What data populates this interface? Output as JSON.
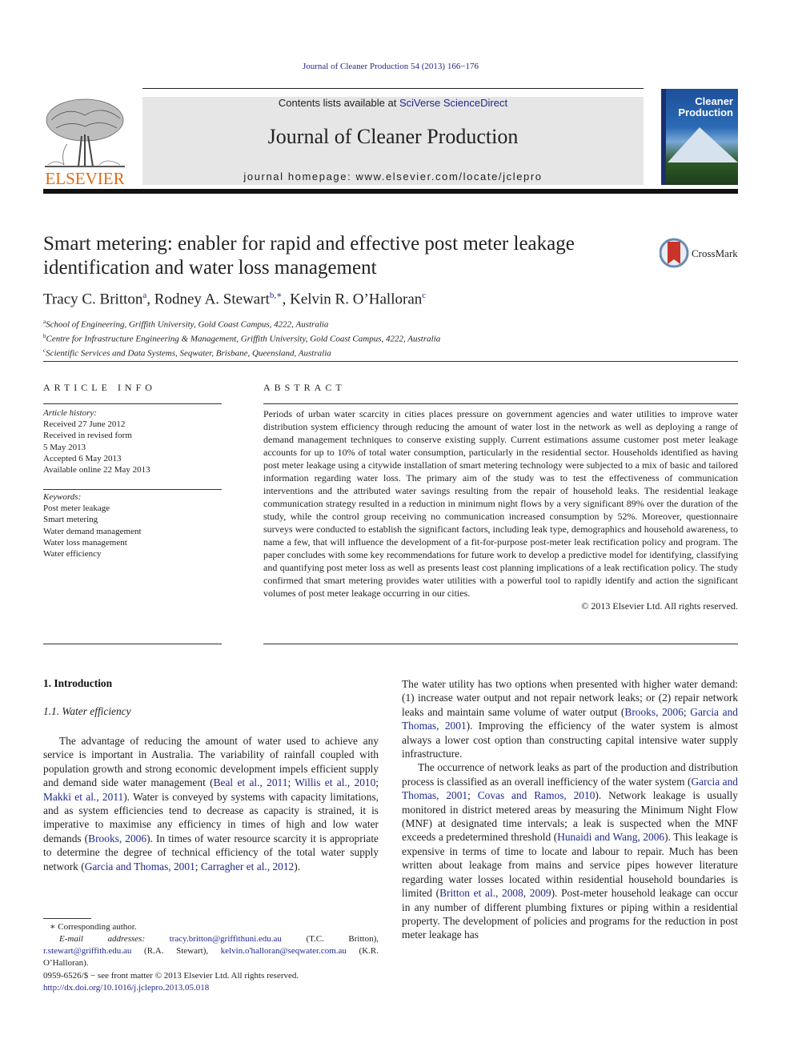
{
  "header": {
    "citation": "Journal of Cleaner Production 54 (2013) 166−176",
    "contents_prefix": "Contents lists available at ",
    "contents_link": "SciVerse ScienceDirect",
    "journal_title": "Journal of Cleaner Production",
    "homepage": "journal homepage: www.elsevier.com/locate/jclepro",
    "publisher": "ELSEVIER",
    "cover": {
      "line1": "Cleaner",
      "line2": "Production"
    },
    "colors": {
      "link": "#1f2a8a",
      "elsevier_orange": "#e06a10",
      "banner_gray": "#e6e6e6"
    }
  },
  "article": {
    "title": "Smart metering: enabler for rapid and effective post meter leakage identification and water loss management",
    "crossmark": "CrossMark",
    "authors": [
      {
        "name": "Tracy C. Britton",
        "sup": "a"
      },
      {
        "name": "Rodney A. Stewart",
        "sup": "b,∗"
      },
      {
        "name": "Kelvin R. O’Halloran",
        "sup": "c"
      }
    ],
    "affiliations": [
      {
        "sup": "a",
        "text": "School of Engineering, Griffith University, Gold Coast Campus, 4222, Australia"
      },
      {
        "sup": "b",
        "text": "Centre for Infrastructure Engineering & Management, Griffith University, Gold Coast Campus, 4222, Australia"
      },
      {
        "sup": "c",
        "text": "Scientific Services and Data Systems, Seqwater, Brisbane, Queensland, Australia"
      }
    ]
  },
  "article_info": {
    "heading": "ARTICLE INFO",
    "history_label": "Article history:",
    "history": [
      "Received 27 June 2012",
      "Received in revised form",
      "5 May 2013",
      "Accepted 6 May 2013",
      "Available online 22 May 2013"
    ],
    "keywords_label": "Keywords:",
    "keywords": [
      "Post meter leakage",
      "Smart metering",
      "Water demand management",
      "Water loss management",
      "Water efficiency"
    ]
  },
  "abstract": {
    "heading": "ABSTRACT",
    "text": "Periods of urban water scarcity in cities places pressure on government agencies and water utilities to improve water distribution system efficiency through reducing the amount of water lost in the network as well as deploying a range of demand management techniques to conserve existing supply. Current estimations assume customer post meter leakage accounts for up to 10% of total water consumption, particularly in the residential sector. Households identified as having post meter leakage using a citywide installation of smart metering technology were subjected to a mix of basic and tailored information regarding water loss. The primary aim of the study was to test the effectiveness of communication interventions and the attributed water savings resulting from the repair of household leaks. The residential leakage communication strategy resulted in a reduction in minimum night flows by a very significant 89% over the duration of the study, while the control group receiving no communication increased consumption by 52%. Moreover, questionnaire surveys were conducted to establish the significant factors, including leak type, demographics and household awareness, to name a few, that will influence the development of a fit-for-purpose post-meter leak rectification policy and program. The paper concludes with some key recommendations for future work to develop a predictive model for identifying, classifying and quantifying post meter loss as well as presents least cost planning implications of a leak rectification policy. The study confirmed that smart metering provides water utilities with a powerful tool to rapidly identify and action the significant volumes of post meter leakage occurring in our cities.",
    "copyright": "© 2013 Elsevier Ltd. All rights reserved."
  },
  "body": {
    "section_heading": "1.  Introduction",
    "subsection_heading": "1.1.  Water efficiency",
    "left_para": [
      {
        "t": "The advantage of reducing the amount of water used to achieve any service is important in Australia. The variability of rainfall coupled with population growth and strong economic development impels efficient supply and demand side water management ("
      },
      {
        "l": "Beal et al., 2011"
      },
      {
        "t": "; "
      },
      {
        "l": "Willis et al., 2010"
      },
      {
        "t": "; "
      },
      {
        "l": "Makki et al., 2011"
      },
      {
        "t": "). Water is conveyed by systems with capacity limitations, and as system efficiencies tend to decrease as capacity is strained, it is imperative to maximise any efficiency in times of high and low water demands ("
      },
      {
        "l": "Brooks, 2006"
      },
      {
        "t": "). In times of water resource scarcity it is appropriate to determine the degree of technical efficiency of the total water supply network ("
      },
      {
        "l": "Garcia and Thomas, 2001"
      },
      {
        "t": "; "
      },
      {
        "l": "Carragher et al., 2012"
      },
      {
        "t": ")."
      }
    ],
    "right_para1": [
      {
        "t": "The water utility has two options when presented with higher water demand: (1) increase water output and not repair network leaks; or (2) repair network leaks and maintain same volume of water output ("
      },
      {
        "l": "Brooks, 2006"
      },
      {
        "t": "; "
      },
      {
        "l": "Garcia and Thomas, 2001"
      },
      {
        "t": "). Improving the efficiency of the water system is almost always a lower cost option than constructing capital intensive water supply infrastructure."
      }
    ],
    "right_para2": [
      {
        "t": "The occurrence of network leaks as part of the production and distribution process is classified as an overall inefficiency of the water system ("
      },
      {
        "l": "Garcia and Thomas, 2001"
      },
      {
        "t": "; "
      },
      {
        "l": "Covas and Ramos, 2010"
      },
      {
        "t": "). Network leakage is usually monitored in district metered areas by measuring the Minimum Night Flow (MNF) at designated time intervals; a leak is suspected when the MNF exceeds a predetermined threshold ("
      },
      {
        "l": "Hunaidi and Wang, 2006"
      },
      {
        "t": "). This leakage is expensive in terms of time to locate and labour to repair. Much has been written about leakage from mains and service pipes however literature regarding water losses located within residential household boundaries is limited ("
      },
      {
        "l": "Britton et al., 2008, 2009"
      },
      {
        "t": "). Post-meter household leakage can occur in any number of different plumbing fixtures or piping within a residential property. The development of policies and programs for the reduction in post meter leakage has"
      }
    ]
  },
  "footnote": {
    "corresponding": "∗ Corresponding author.",
    "email_label": "E-mail addresses: ",
    "emails": [
      {
        "addr": "tracy.britton@griffithuni.edu.au",
        "who": " (T.C. Britton), "
      },
      {
        "addr": "r.stewart@griffith.edu.au",
        "who": " (R.A. Stewart), "
      },
      {
        "addr": "kelvin.o'halloran@seqwater.com.au",
        "who": " (K.R. O’Halloran)."
      }
    ],
    "front_matter": "0959-6526/$ − see front matter © 2013 Elsevier Ltd. All rights reserved.",
    "doi": "http://dx.doi.org/10.1016/j.jclepro.2013.05.018"
  }
}
